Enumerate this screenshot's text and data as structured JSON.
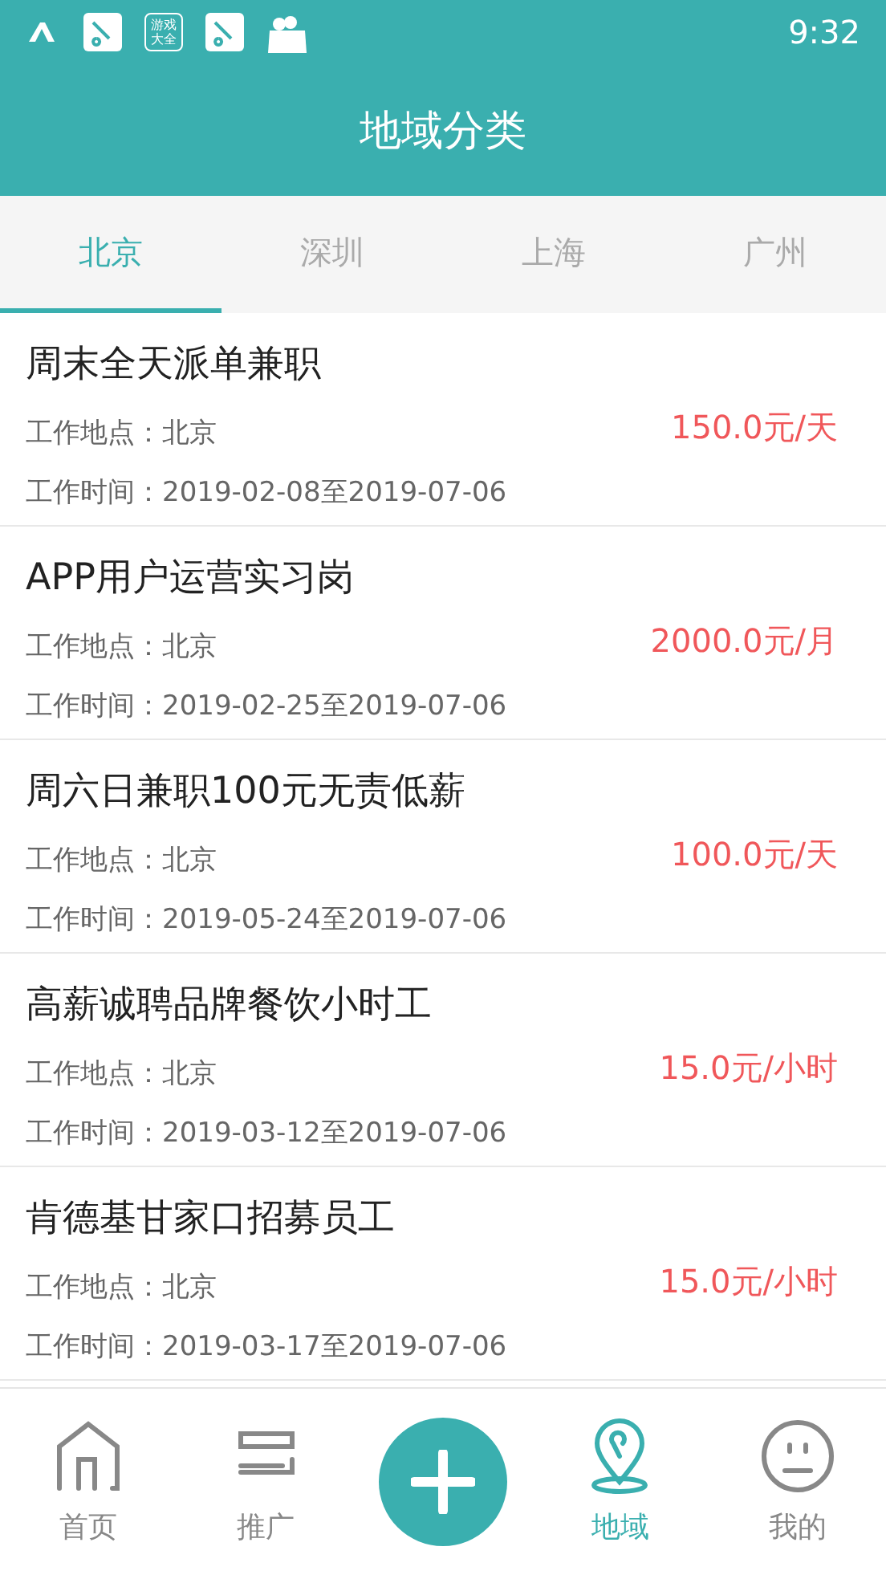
{
  "status_bar": {
    "badge_text": [
      "游戏",
      "大全"
    ],
    "time": "9:32"
  },
  "header": {
    "title": "地域分类"
  },
  "tabs": [
    {
      "label": "北京",
      "selected": true
    },
    {
      "label": "深圳",
      "selected": false
    },
    {
      "label": "上海",
      "selected": false
    },
    {
      "label": "广州",
      "selected": false
    }
  ],
  "jobs": [
    {
      "title": "周末全天派单兼职",
      "location": "工作地点：北京",
      "time": "工作时间：2019-02-08至2019-07-06",
      "salary": "150.0元/天"
    },
    {
      "title": "APP用户运营实习岗",
      "location": "工作地点：北京",
      "time": "工作时间：2019-02-25至2019-07-06",
      "salary": "2000.0元/月"
    },
    {
      "title": "周六日兼职100元无责低薪",
      "location": "工作地点：北京",
      "time": "工作时间：2019-05-24至2019-07-06",
      "salary": "100.0元/天"
    },
    {
      "title": "高薪诚聘品牌餐饮小时工",
      "location": "工作地点：北京",
      "time": "工作时间：2019-03-12至2019-07-06",
      "salary": "15.0元/小时"
    },
    {
      "title": "肯德基甘家口招募员工",
      "location": "工作地点：北京",
      "time": "工作时间：2019-03-17至2019-07-06",
      "salary": "15.0元/小时"
    }
  ],
  "nav": [
    {
      "kind": "home",
      "label": "首页",
      "selected": false
    },
    {
      "kind": "promote",
      "label": "推广",
      "selected": false
    },
    {
      "kind": "add"
    },
    {
      "kind": "region",
      "label": "地域",
      "selected": true
    },
    {
      "kind": "me",
      "label": "我的",
      "selected": false
    }
  ]
}
